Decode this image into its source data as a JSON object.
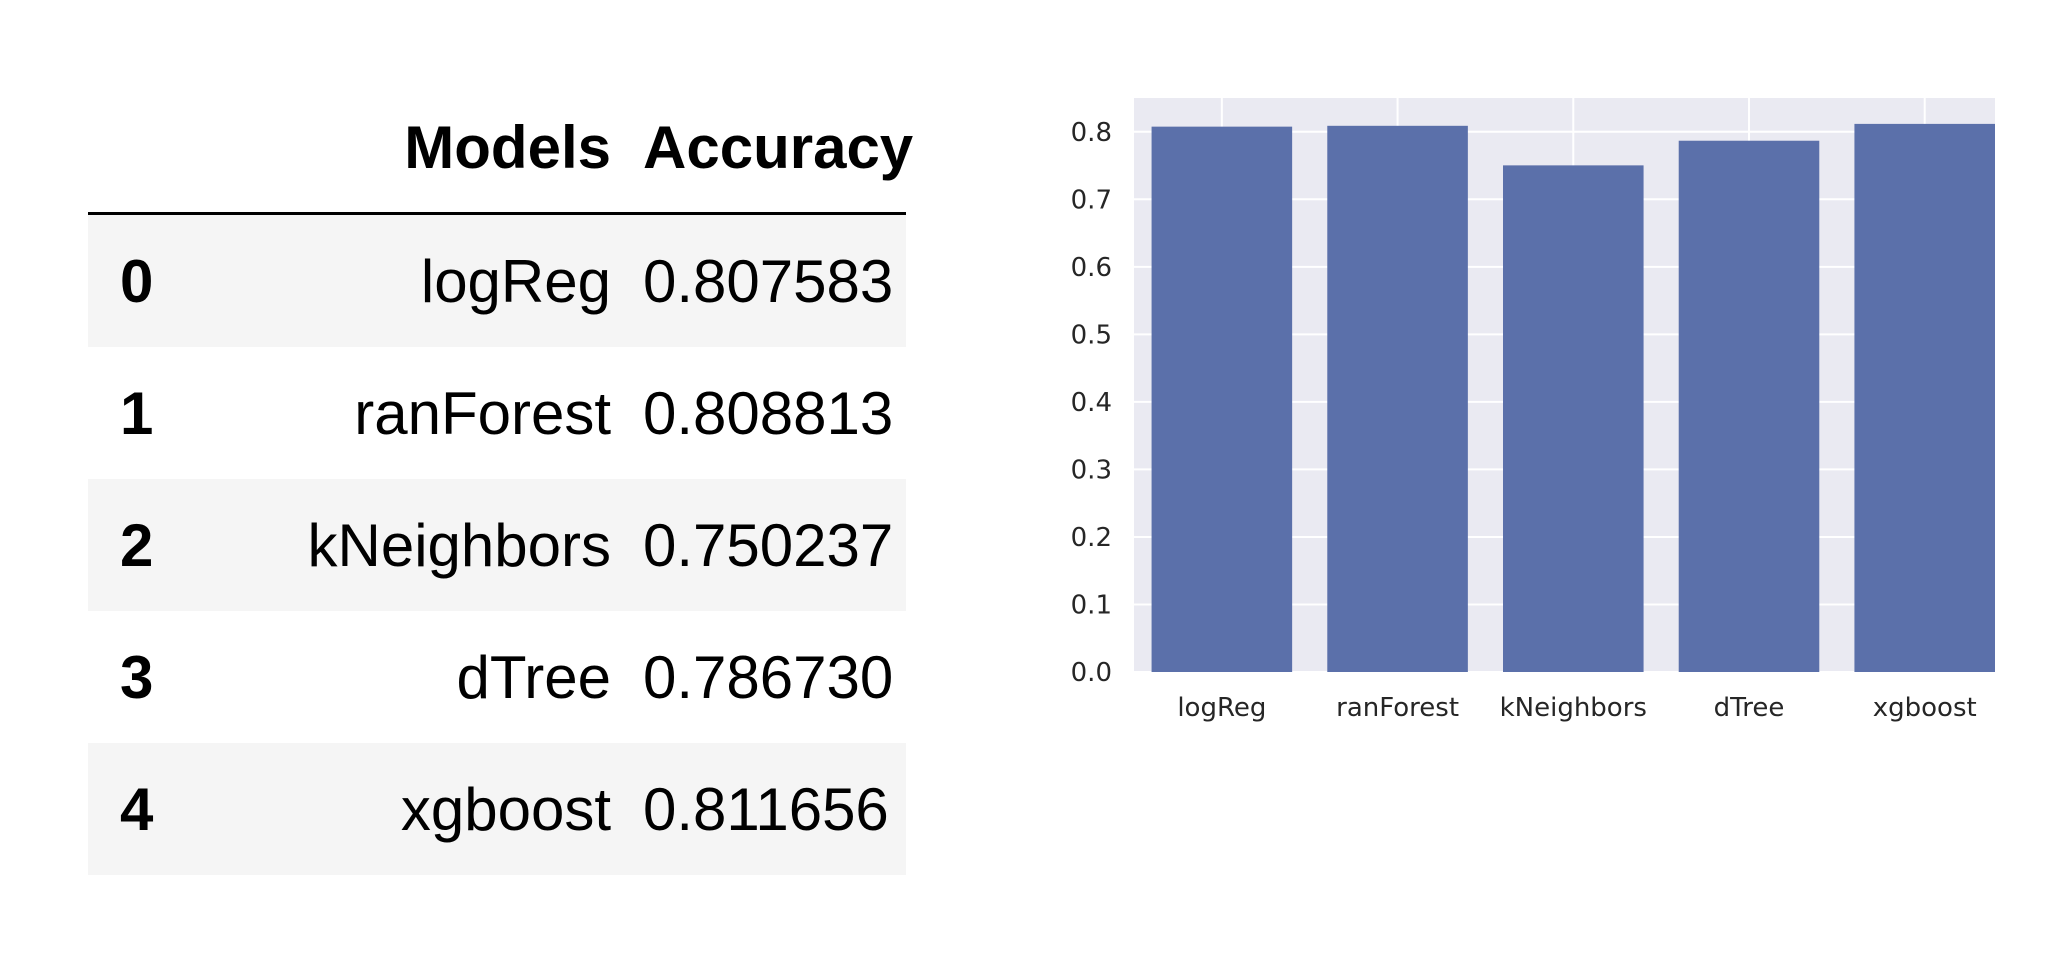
{
  "table": {
    "columns": [
      "",
      "Models",
      "Accuracy"
    ],
    "rows": [
      {
        "index": "0",
        "model": "logReg",
        "accuracy": "0.807583"
      },
      {
        "index": "1",
        "model": "ranForest",
        "accuracy": "0.808813"
      },
      {
        "index": "2",
        "model": "kNeighbors",
        "accuracy": "0.750237"
      },
      {
        "index": "3",
        "model": "dTree",
        "accuracy": "0.786730"
      },
      {
        "index": "4",
        "model": "xgboost",
        "accuracy": "0.811656"
      }
    ]
  },
  "chart_data": {
    "type": "bar",
    "categories": [
      "logReg",
      "ranForest",
      "kNeighbors",
      "dTree",
      "xgboost"
    ],
    "values": [
      0.807583,
      0.808813,
      0.750237,
      0.78673,
      0.811656
    ],
    "title": "",
    "xlabel": "",
    "ylabel": "",
    "ylim": [
      0,
      0.85
    ],
    "yticks": [
      "0.0",
      "0.1",
      "0.2",
      "0.3",
      "0.4",
      "0.5",
      "0.6",
      "0.7",
      "0.8"
    ],
    "grid": true,
    "colors": {
      "bar": "#5b70aa",
      "background": "#eaeaf2",
      "grid": "#ffffff"
    }
  }
}
